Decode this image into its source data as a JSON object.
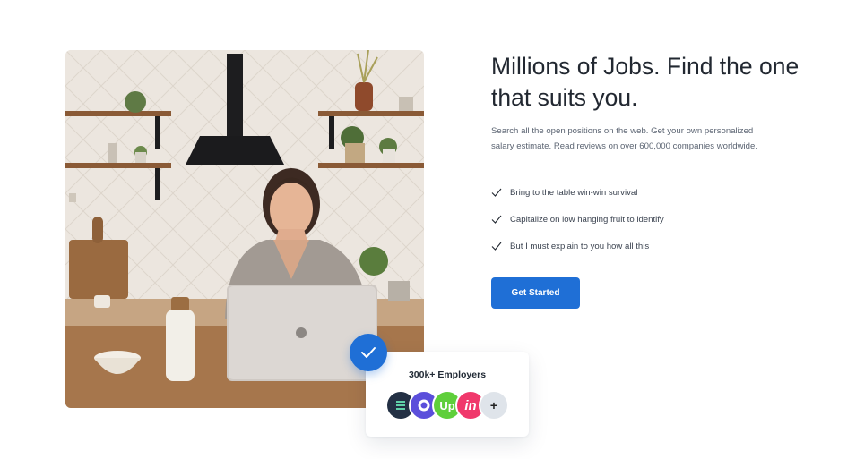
{
  "hero": {
    "headline": "Millions of Jobs. Find the one that suits you.",
    "description": "Search all the open positions on the web. Get your own personalized salary estimate. Read reviews on over 600,000 companies worldwide.",
    "features": [
      "Bring to the table win-win survival",
      "Capitalize on low hanging fruit to identify",
      "But I must explain to you how all this"
    ],
    "cta_label": "Get Started"
  },
  "employers": {
    "title": "300k+ Employers",
    "logos": [
      {
        "icon": "striped-s-logo-icon",
        "color": "#233044"
      },
      {
        "icon": "ring-logo-icon",
        "color": "#5b4fdb"
      },
      {
        "icon": "upwork-logo-icon",
        "text": "Up",
        "color": "#5fcf3b"
      },
      {
        "icon": "invision-logo-icon",
        "text": "in",
        "color": "#f0386b"
      },
      {
        "icon": "plus-icon",
        "text": "+",
        "color": "#dfe4ea"
      }
    ]
  },
  "colors": {
    "accent": "#1f6fd6",
    "heading": "#222831",
    "body_text": "#5b6472"
  }
}
